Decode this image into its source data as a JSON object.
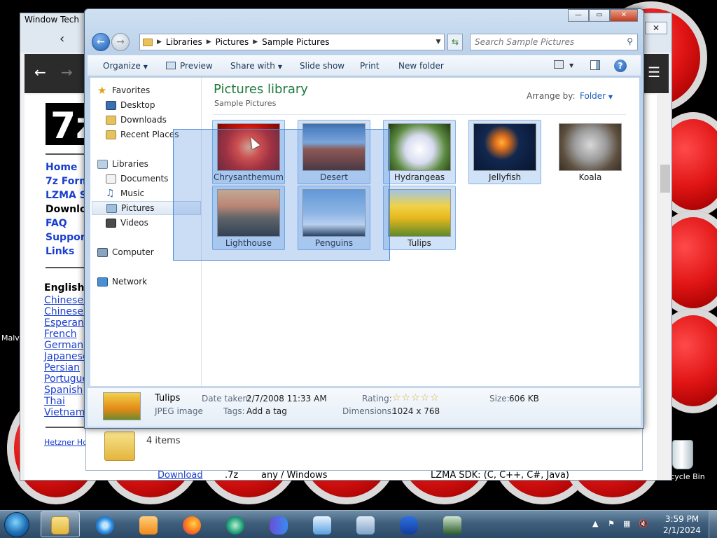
{
  "desktop": {
    "left_label_1": "Malv",
    "recycle_bin": "Recycle Bin"
  },
  "browser": {
    "title": "Window Tech",
    "logo_text": "7z",
    "nav": [
      "Home",
      "7z Form",
      "LZMA SI",
      "Downlo",
      "FAQ",
      "Support",
      "Links"
    ],
    "lang_header": "English",
    "languages": [
      "Chinese S",
      "Chinese T",
      "Esperant",
      "French",
      "German",
      "Japanese",
      "Persian",
      "Portugue",
      "Spanish",
      "Thai",
      "Vietname"
    ],
    "host_link": "Hetzner Ho",
    "table_row": [
      "Download",
      ".7z",
      "any / Windows",
      "LZMA SDK: (C, C++, C#, Java)"
    ]
  },
  "explorer": {
    "breadcrumb": [
      "Libraries",
      "Pictures",
      "Sample Pictures"
    ],
    "search_placeholder": "Search Sample Pictures",
    "toolbar": {
      "organize": "Organize",
      "preview": "Preview",
      "share_with": "Share with",
      "slide_show": "Slide show",
      "print": "Print",
      "new_folder": "New folder"
    },
    "nav_pane": {
      "favorites": "Favorites",
      "desktop": "Desktop",
      "downloads": "Downloads",
      "recent_places": "Recent Places",
      "libraries": "Libraries",
      "documents": "Documents",
      "music": "Music",
      "pictures": "Pictures",
      "videos": "Videos",
      "computer": "Computer",
      "network": "Network"
    },
    "library_title": "Pictures library",
    "library_subtitle": "Sample Pictures",
    "arrange_by_label": "Arrange by:",
    "arrange_by_value": "Folder",
    "pictures": [
      {
        "name": "Chrysanthemum",
        "selected": true
      },
      {
        "name": "Desert",
        "selected": true
      },
      {
        "name": "Hydrangeas",
        "selected": true
      },
      {
        "name": "Jellyfish",
        "selected": true
      },
      {
        "name": "Koala",
        "selected": false
      },
      {
        "name": "Lighthouse",
        "selected": true
      },
      {
        "name": "Penguins",
        "selected": true
      },
      {
        "name": "Tulips",
        "selected": true
      }
    ],
    "details": {
      "name": "Tulips",
      "type": "JPEG image",
      "date_taken_label": "Date taken:",
      "date_taken_value": "2/7/2008 11:33 AM",
      "tags_label": "Tags:",
      "tags_value": "Add a tag",
      "rating_label": "Rating:",
      "rating_stars": "☆☆☆☆☆",
      "dimensions_label": "Dimensions:",
      "dimensions_value": "1024 x 768",
      "size_label": "Size:",
      "size_value": "606 KB"
    }
  },
  "folder_window": {
    "item_count": "4 items"
  },
  "taskbar": {
    "time": "3:59 PM",
    "date": "2/1/2024"
  }
}
